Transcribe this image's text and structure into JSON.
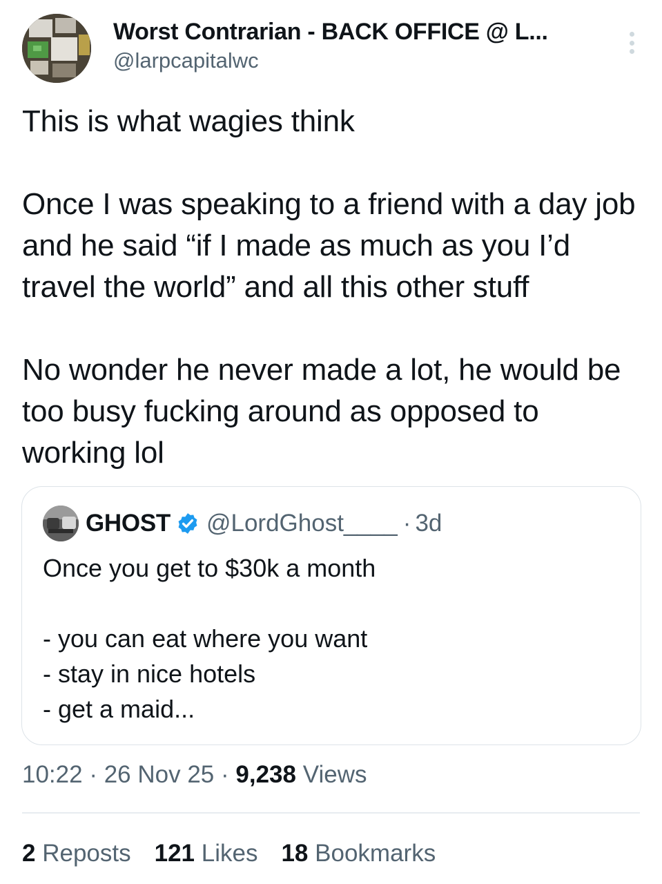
{
  "author": {
    "display_name": "Worst Contrarian - BACK OFFICE @ L...",
    "handle": "@larpcapitalwc"
  },
  "tweet": {
    "text": "This is what wagies think\n\nOnce I was speaking to a friend with a day job and he said “if I made as much as you I’d travel the world” and all this other stuff\n\nNo wonder he never made a lot, he would be too busy fucking around as opposed to working lol"
  },
  "quoted_tweet": {
    "display_name": "GHOST",
    "handle": "@LordGhost____",
    "separator": "·",
    "age": "3d",
    "text": "Once you get to $30k a month\n\n- you can eat where you want\n- stay in nice hotels\n- get a maid..."
  },
  "meta": {
    "time": "10:22",
    "date": "26 Nov 25",
    "views_count": "9,238",
    "views_label": "Views",
    "separator": "·"
  },
  "stats": {
    "reposts_count": "2",
    "reposts_label": "Reposts",
    "likes_count": "121",
    "likes_label": "Likes",
    "bookmarks_count": "18",
    "bookmarks_label": "Bookmarks"
  },
  "colors": {
    "text": "#0f1419",
    "secondary": "#536471",
    "verified": "#1d9bf0",
    "border": "#dde3e8"
  },
  "icons": {
    "more": "more-vertical-icon",
    "verified": "verified-badge-icon"
  }
}
